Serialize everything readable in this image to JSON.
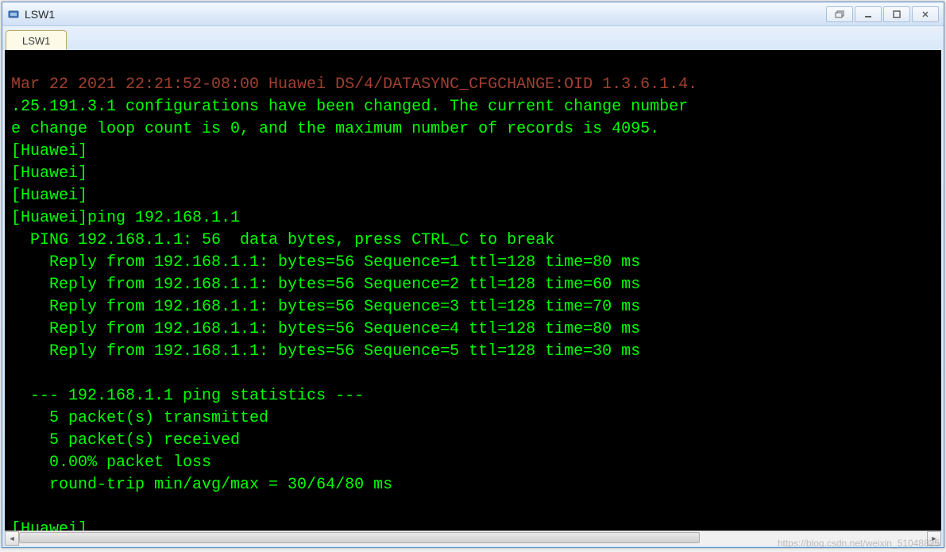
{
  "window": {
    "title": "LSW1"
  },
  "tabs": [
    {
      "label": "LSW1"
    }
  ],
  "terminal": {
    "lines": [
      "Mar 22 2021 22:21:52-08:00 Huawei DS/4/DATASYNC_CFGCHANGE:OID 1.3.6.1.4.",
      ".25.191.3.1 configurations have been changed. The current change number",
      "e change loop count is 0, and the maximum number of records is 4095.",
      "[Huawei]",
      "[Huawei]",
      "[Huawei]",
      "[Huawei]ping 192.168.1.1",
      "  PING 192.168.1.1: 56  data bytes, press CTRL_C to break",
      "    Reply from 192.168.1.1: bytes=56 Sequence=1 ttl=128 time=80 ms",
      "    Reply from 192.168.1.1: bytes=56 Sequence=2 ttl=128 time=60 ms",
      "    Reply from 192.168.1.1: bytes=56 Sequence=3 ttl=128 time=70 ms",
      "    Reply from 192.168.1.1: bytes=56 Sequence=4 ttl=128 time=80 ms",
      "    Reply from 192.168.1.1: bytes=56 Sequence=5 ttl=128 time=30 ms",
      "",
      "  --- 192.168.1.1 ping statistics ---",
      "    5 packet(s) transmitted",
      "    5 packet(s) received",
      "    0.00% packet loss",
      "    round-trip min/avg/max = 30/64/80 ms",
      "",
      "[Huawei]"
    ]
  },
  "watermark": "https://blog.csdn.net/weixin_51048825"
}
